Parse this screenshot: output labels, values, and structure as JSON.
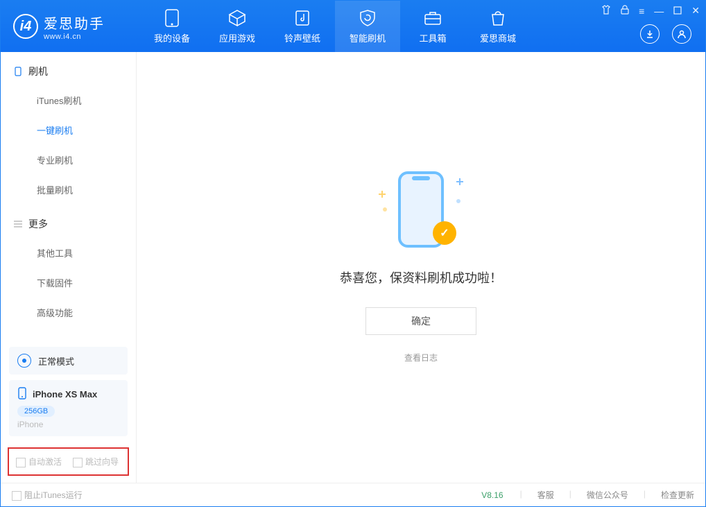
{
  "header": {
    "app_name_cn": "爱思助手",
    "app_name_en": "www.i4.cn",
    "nav": [
      {
        "label": "我的设备"
      },
      {
        "label": "应用游戏"
      },
      {
        "label": "铃声壁纸"
      },
      {
        "label": "智能刷机"
      },
      {
        "label": "工具箱"
      },
      {
        "label": "爱思商城"
      }
    ],
    "active_nav": 3
  },
  "sidebar": {
    "group1_title": "刷机",
    "group1_items": [
      "iTunes刷机",
      "一键刷机",
      "专业刷机",
      "批量刷机"
    ],
    "group1_active": 1,
    "group2_title": "更多",
    "group2_items": [
      "其他工具",
      "下载固件",
      "高级功能"
    ],
    "mode_label": "正常模式",
    "device": {
      "name": "iPhone XS Max",
      "capacity": "256GB",
      "type": "iPhone"
    },
    "opts": {
      "auto_activate": "自动激活",
      "skip_guide": "跳过向导"
    }
  },
  "main": {
    "success_msg": "恭喜您，保资料刷机成功啦！",
    "ok_button": "确定",
    "view_log": "查看日志"
  },
  "statusbar": {
    "block_itunes": "阻止iTunes运行",
    "version": "V8.16",
    "links": [
      "客服",
      "微信公众号",
      "检查更新"
    ]
  }
}
